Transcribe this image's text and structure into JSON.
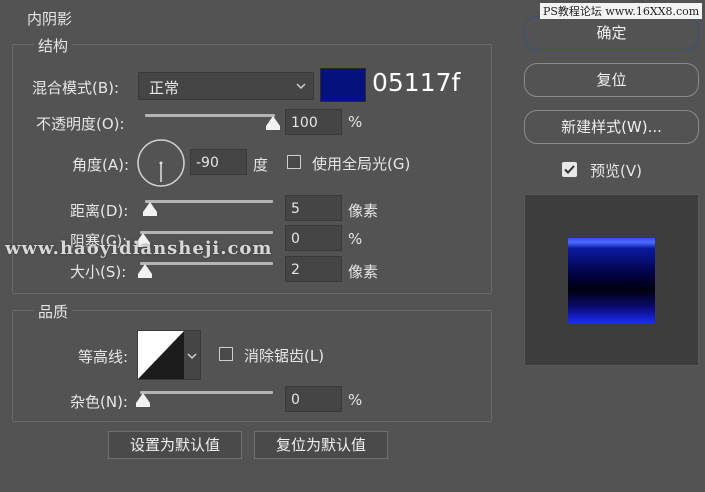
{
  "dialog": {
    "title": "内阴影",
    "structure": {
      "legend": "结构",
      "blend_mode_label": "混合模式(B):",
      "blend_mode_value": "正常",
      "color_hex_label": "05117f",
      "swatch_color": "#05117f",
      "opacity_label": "不透明度(O):",
      "opacity_value": "100",
      "opacity_unit": "%",
      "opacity_level": 1.0,
      "angle_label": "角度(A):",
      "angle_value": "-90",
      "angle_unit": "度",
      "global_light_label": "使用全局光(G)",
      "global_light_checked": false,
      "distance_label": "距离(D):",
      "distance_value": "5",
      "distance_unit": "像素",
      "choke_label": "阻塞(C):",
      "choke_value": "0",
      "choke_unit": "%",
      "size_label": "大小(S):",
      "size_value": "2",
      "size_unit": "像素"
    },
    "quality": {
      "legend": "品质",
      "contour_label": "等高线:",
      "anti_alias_label": "消除锯齿(L)",
      "anti_alias_checked": false,
      "noise_label": "杂色(N):",
      "noise_value": "0",
      "noise_unit": "%"
    },
    "buttons": {
      "make_default": "设置为默认值",
      "reset_default": "复位为默认值",
      "ok": "确定",
      "reset": "复位",
      "new_style": "新建样式(W)...",
      "preview_label": "预览(V)",
      "preview_checked": true
    }
  },
  "watermarks": {
    "top_right": "PS教程论坛 www.16XX8.com",
    "middle": "www.haoyidiansheji.com"
  },
  "colors": {
    "background": "#535353",
    "swatch": "#05117f",
    "preview_gradient_top": "#2a4dff",
    "preview_gradient_mid": "#00001a",
    "preview_gradient_bottom": "#1a2cff"
  }
}
